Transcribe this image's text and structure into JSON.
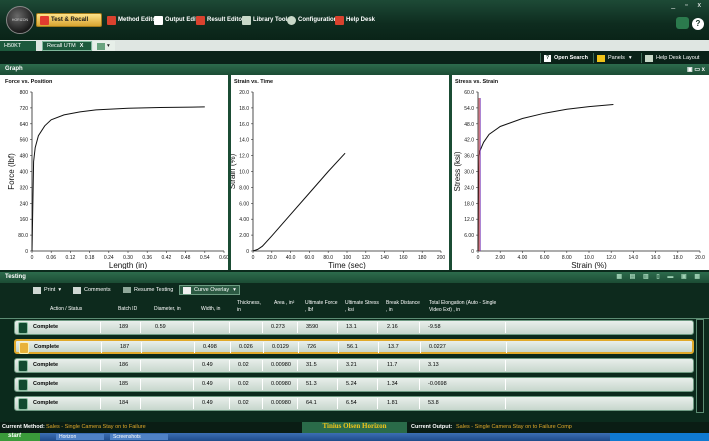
{
  "app": {
    "logo_text": "HORIZON",
    "window_controls": "_ ▫ x",
    "help": "?"
  },
  "menu": [
    {
      "label": "Test & Recall",
      "icon": "test-recall-icon",
      "color": "#e23b2f"
    },
    {
      "label": "Method Editor",
      "icon": "method-editor-icon",
      "color": "#d9422e"
    },
    {
      "label": "Output Editor",
      "icon": "output-editor-icon",
      "color": "#ffffff"
    },
    {
      "label": "Result Editor",
      "icon": "result-editor-icon",
      "color": "#d9422e"
    },
    {
      "label": "Library Tools",
      "icon": "library-tools-icon",
      "color": "#c8d8c8"
    },
    {
      "label": "Configuration",
      "icon": "configuration-icon",
      "color": "#c8d8c8"
    },
    {
      "label": "Help Desk",
      "icon": "help-desk-icon",
      "color": "#d9422e"
    }
  ],
  "tabs": {
    "tab0": "H50KT",
    "tab1": "Recall UTM",
    "tab1_close": "X",
    "add": "▾"
  },
  "toolbar": {
    "open_search": "Open Search",
    "panels": "Panels",
    "help_desk_layout": "Help Desk Layout"
  },
  "graph_section": {
    "title": "Graph"
  },
  "testing_section": {
    "title": "Testing"
  },
  "testing_toolbar": {
    "print": "Print",
    "comments": "Comments",
    "resume": "Resume Testing",
    "curve_overlay": "Curve Overlay"
  },
  "columns": [
    "Action / Status",
    "Batch ID",
    "Diameter, in",
    "Width, in",
    "Thickness, in",
    "Area , in²",
    "Ultimate Force , lbf",
    "Ultimate Stress , ksi",
    "Break Distance , in",
    "Total Elongation (Auto - Single Video Ext) , in"
  ],
  "rows": [
    {
      "status": "Complete",
      "batch": "189",
      "diameter": "0.59",
      "width": "",
      "thickness": "",
      "area": "0.273",
      "force": "3590",
      "stress": "13.1",
      "break": "2.16",
      "elong": "-9.58",
      "selected": false
    },
    {
      "status": "Complete",
      "batch": "187",
      "diameter": "",
      "width": "0.498",
      "thickness": "0.026",
      "area": "0.0129",
      "force": "726",
      "stress": "56.1",
      "break": "13.7",
      "elong": "0.0227",
      "selected": true
    },
    {
      "status": "Complete",
      "batch": "186",
      "diameter": "",
      "width": "0.49",
      "thickness": "0.02",
      "area": "0.00980",
      "force": "31.5",
      "stress": "3.21",
      "break": "11.7",
      "elong": "3.13",
      "selected": false
    },
    {
      "status": "Complete",
      "batch": "185",
      "diameter": "",
      "width": "0.49",
      "thickness": "0.02",
      "area": "0.00980",
      "force": "51.3",
      "stress": "5.24",
      "break": "1.34",
      "elong": "-0.0698",
      "selected": false
    },
    {
      "status": "Complete",
      "batch": "184",
      "diameter": "",
      "width": "0.49",
      "thickness": "0.02",
      "area": "0.00980",
      "force": "64.1",
      "stress": "6.54",
      "break": "1.81",
      "elong": "53.8",
      "selected": false
    }
  ],
  "status_bar": {
    "method_label": "Current Method:",
    "method_value": "Sales - Single Camera Stay on to Failure",
    "brand": "Tinius Olsen Horizon",
    "output_label": "Current Output:",
    "output_value": "Sales - Single Camera Stay on to Failure Comp"
  },
  "taskbar": {
    "start": "start",
    "item1": "Horizon",
    "item2": "Screenshots"
  },
  "chart_data": [
    {
      "type": "line",
      "title": "Force vs. Position",
      "xlabel": "Length (in)",
      "ylabel": "Force (lbf)",
      "xlim": [
        0,
        0.6
      ],
      "ylim": [
        0,
        800
      ],
      "xticks": [
        "0",
        "0.06",
        "0.12",
        "0.18",
        "0.24",
        "0.30",
        "0.36",
        "0.42",
        "0.48",
        "0.54",
        "0.60"
      ],
      "yticks": [
        "0",
        "80.0",
        "160",
        "240",
        "320",
        "400",
        "480",
        "560",
        "640",
        "720",
        "800"
      ],
      "series": [
        {
          "x": [
            0,
            0.005,
            0.01,
            0.02,
            0.04,
            0.06,
            0.1,
            0.15,
            0.2,
            0.3,
            0.4,
            0.5,
            0.54
          ],
          "y": [
            0,
            450,
            520,
            580,
            630,
            660,
            685,
            700,
            710,
            718,
            722,
            724,
            725
          ]
        }
      ]
    },
    {
      "type": "line",
      "title": "Strain vs. Time",
      "xlabel": "Time (sec)",
      "ylabel": "Strain (%)",
      "xlim": [
        0,
        200
      ],
      "ylim": [
        0,
        20
      ],
      "xticks": [
        "0",
        "20.0",
        "40.0",
        "60.0",
        "80.0",
        "100",
        "120",
        "140",
        "160",
        "180",
        "200"
      ],
      "yticks": [
        "0",
        "2.00",
        "4.00",
        "6.00",
        "8.00",
        "10.0",
        "12.0",
        "14.0",
        "16.0",
        "18.0",
        "20.0"
      ],
      "series": [
        {
          "x": [
            0,
            5,
            10,
            20,
            40,
            60,
            80,
            98
          ],
          "y": [
            0,
            0.2,
            0.6,
            1.9,
            4.6,
            7.3,
            10.0,
            12.3
          ]
        }
      ]
    },
    {
      "type": "line",
      "title": "Stress vs. Strain",
      "xlabel": "Strain (%)",
      "ylabel": "Stress (ksi)",
      "xlim": [
        0,
        20
      ],
      "ylim": [
        0,
        60
      ],
      "xticks": [
        "0",
        "2.00",
        "4.00",
        "6.00",
        "8.00",
        "10.0",
        "12.0",
        "14.0",
        "16.0",
        "18.0",
        "20.0"
      ],
      "yticks": [
        "0",
        "6.00",
        "12.0",
        "18.0",
        "24.0",
        "30.0",
        "36.0",
        "42.0",
        "48.0",
        "54.0",
        "60.0"
      ],
      "series": [
        {
          "x": [
            0,
            0.05,
            0.1,
            0.2,
            0.5,
            1,
            2,
            4,
            6,
            8,
            10,
            12.2
          ],
          "y": [
            0,
            30,
            36,
            38,
            41,
            44,
            47,
            50,
            52,
            53.5,
            54.5,
            55.3
          ]
        }
      ]
    }
  ],
  "colors": {
    "accent": "#e0a92a",
    "header_green": "#1b4c34",
    "brand": "#f0c419"
  }
}
